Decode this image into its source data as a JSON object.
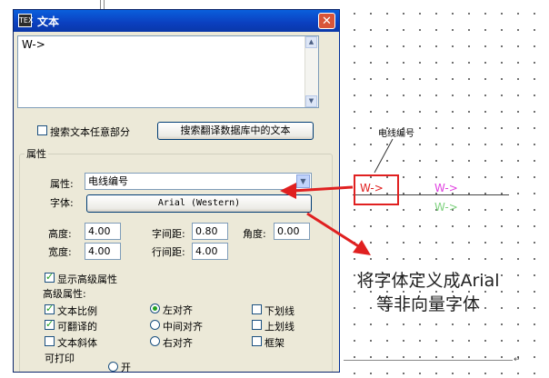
{
  "dialog": {
    "title": "文本",
    "title_icon": "TEX",
    "close_label": "✕",
    "text_value": "W->",
    "search_any_label": "搜索文本任意部分",
    "search_db_button": "搜索翻译数据库中的文本",
    "properties_group": "属性",
    "attribute_label": "属性:",
    "attribute_value": "电线编号",
    "font_label": "字体:",
    "font_button": "Arial  (Western)",
    "height_label": "高度:",
    "height_value": "4.00",
    "char_spacing_label": "字间距:",
    "char_spacing_value": "0.80",
    "angle_label": "角度:",
    "angle_value": "0.00",
    "width_label": "宽度:",
    "width_value": "4.00",
    "line_spacing_label": "行间距:",
    "line_spacing_value": "4.00",
    "show_advanced_label": "显示高级属性",
    "advanced_group": "高级属性:",
    "text_ratio_label": "文本比例",
    "translatable_label": "可翻译的",
    "text_italic_label": "文本斜体",
    "align_left_label": "左对齐",
    "align_center_label": "中间对齐",
    "align_right_label": "右对齐",
    "underline_label": "下划线",
    "overline_label": "上划线",
    "frame_label": "框架",
    "printable_label": "可打印",
    "on_label": "开"
  },
  "canvas": {
    "annotation_label": "电线编号",
    "wire_text_red": "W->",
    "wire_text_magenta": "W->",
    "wire_text_green": "W->",
    "callout_line1": "将字体定义成Arial",
    "callout_line2": "等非向量字体",
    "corner_mark": "↵"
  },
  "colors": {
    "accent_red": "#e02020",
    "magenta": "#e040e0",
    "green": "#7ed27e",
    "titlebar": "#0b3fbf"
  }
}
